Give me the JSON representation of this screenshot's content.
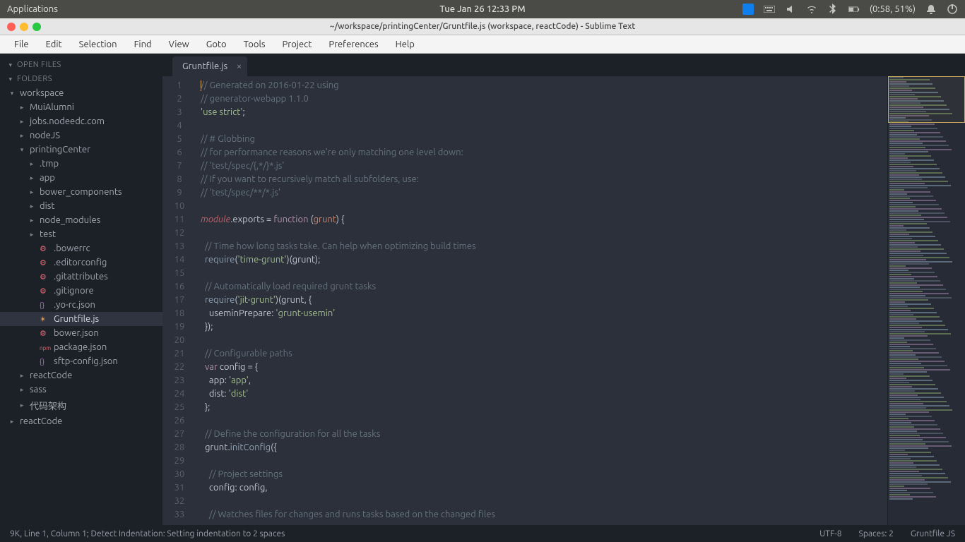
{
  "topbar": {
    "applications": "Applications",
    "datetime": "Tue Jan 26 12:33 PM",
    "battery": "(0:58, 51%)"
  },
  "window": {
    "title": "~/workspace/printingCenter/Gruntfile.js (workspace, reactCode) - Sublime Text"
  },
  "menu": [
    "File",
    "Edit",
    "Selection",
    "Find",
    "View",
    "Goto",
    "Tools",
    "Project",
    "Preferences",
    "Help"
  ],
  "sidebar": {
    "open_files": "OPEN FILES",
    "folders": "FOLDERS",
    "tree": [
      {
        "l": "workspace",
        "d": 1,
        "exp": true,
        "i": 0
      },
      {
        "l": "MuiAlumni",
        "d": 1,
        "i": 1
      },
      {
        "l": "jobs.nodeedc.com",
        "d": 1,
        "i": 1
      },
      {
        "l": "nodeJS",
        "d": 1,
        "i": 1
      },
      {
        "l": "printingCenter",
        "d": 1,
        "exp": true,
        "i": 1
      },
      {
        "l": ".tmp",
        "d": 1,
        "i": 2
      },
      {
        "l": "app",
        "d": 1,
        "i": 2
      },
      {
        "l": "bower_components",
        "d": 1,
        "i": 2
      },
      {
        "l": "dist",
        "d": 1,
        "i": 2
      },
      {
        "l": "node_modules",
        "d": 1,
        "i": 2
      },
      {
        "l": "test",
        "d": 1,
        "i": 2
      },
      {
        "l": ".bowerrc",
        "ic": "config",
        "i": 2
      },
      {
        "l": ".editorconfig",
        "ic": "config",
        "i": 2
      },
      {
        "l": ".gitattributes",
        "ic": "config",
        "i": 2
      },
      {
        "l": ".gitignore",
        "ic": "config",
        "i": 2
      },
      {
        "l": ".yo-rc.json",
        "ic": "json",
        "i": 2
      },
      {
        "l": "Gruntfile.js",
        "ic": "js",
        "i": 2,
        "sel": true
      },
      {
        "l": "bower.json",
        "ic": "config",
        "i": 2
      },
      {
        "l": "package.json",
        "ic": "pkg",
        "i": 2
      },
      {
        "l": "sftp-config.json",
        "ic": "json",
        "i": 2
      },
      {
        "l": "reactCode",
        "d": 1,
        "i": 1
      },
      {
        "l": "sass",
        "d": 1,
        "i": 1
      },
      {
        "l": "代码架构",
        "d": 1,
        "i": 1
      },
      {
        "l": "reactCode",
        "d": 1,
        "i": 0
      }
    ]
  },
  "tab": {
    "label": "Gruntfile.js"
  },
  "code_lines": [
    [
      {
        "c": "cm",
        "t": "// Generated on 2016-01-22 using"
      }
    ],
    [
      {
        "c": "cm",
        "t": "// generator-webapp 1.1.0"
      }
    ],
    [
      {
        "c": "str",
        "t": "'use strict'"
      },
      {
        "c": "op",
        "t": ";"
      }
    ],
    [],
    [
      {
        "c": "cm",
        "t": "// # Globbing"
      }
    ],
    [
      {
        "c": "cm",
        "t": "// for performance reasons we're only matching one level down:"
      }
    ],
    [
      {
        "c": "cm",
        "t": "// 'test/spec/{,*/}*.js'"
      }
    ],
    [
      {
        "c": "cm",
        "t": "// If you want to recursively match all subfolders, use:"
      }
    ],
    [
      {
        "c": "cm",
        "t": "// 'test/spec/**/*.js'"
      }
    ],
    [],
    [
      {
        "c": "red",
        "t": "module"
      },
      {
        "c": "op",
        "t": "."
      },
      {
        "c": "var",
        "t": "exports"
      },
      {
        "c": "op",
        "t": " = "
      },
      {
        "c": "kw",
        "t": "function"
      },
      {
        "c": "op",
        "t": " ("
      },
      {
        "c": "num",
        "t": "grunt"
      },
      {
        "c": "op",
        "t": ") {"
      }
    ],
    [],
    [
      {
        "c": "op",
        "t": "  "
      },
      {
        "c": "cm",
        "t": "// Time how long tasks take. Can help when optimizing build times"
      }
    ],
    [
      {
        "c": "op",
        "t": "  "
      },
      {
        "c": "fn",
        "t": "require"
      },
      {
        "c": "op",
        "t": "("
      },
      {
        "c": "str",
        "t": "'time-grunt'"
      },
      {
        "c": "op",
        "t": ")(grunt);"
      }
    ],
    [],
    [
      {
        "c": "op",
        "t": "  "
      },
      {
        "c": "cm",
        "t": "// Automatically load required grunt tasks"
      }
    ],
    [
      {
        "c": "op",
        "t": "  "
      },
      {
        "c": "fn",
        "t": "require"
      },
      {
        "c": "op",
        "t": "("
      },
      {
        "c": "str",
        "t": "'jit-grunt'"
      },
      {
        "c": "op",
        "t": ")(grunt, {"
      }
    ],
    [
      {
        "c": "op",
        "t": "    useminPrepare: "
      },
      {
        "c": "str",
        "t": "'grunt-usemin'"
      }
    ],
    [
      {
        "c": "op",
        "t": "  });"
      }
    ],
    [],
    [
      {
        "c": "op",
        "t": "  "
      },
      {
        "c": "cm",
        "t": "// Configurable paths"
      }
    ],
    [
      {
        "c": "op",
        "t": "  "
      },
      {
        "c": "kw",
        "t": "var"
      },
      {
        "c": "op",
        "t": " config = {"
      }
    ],
    [
      {
        "c": "op",
        "t": "    app: "
      },
      {
        "c": "str",
        "t": "'app'"
      },
      {
        "c": "op",
        "t": ","
      }
    ],
    [
      {
        "c": "op",
        "t": "    dist: "
      },
      {
        "c": "str",
        "t": "'dist'"
      }
    ],
    [
      {
        "c": "op",
        "t": "  };"
      }
    ],
    [],
    [
      {
        "c": "op",
        "t": "  "
      },
      {
        "c": "cm",
        "t": "// Define the configuration for all the tasks"
      }
    ],
    [
      {
        "c": "op",
        "t": "  grunt."
      },
      {
        "c": "fn",
        "t": "initConfig"
      },
      {
        "c": "op",
        "t": "({"
      }
    ],
    [],
    [
      {
        "c": "op",
        "t": "    "
      },
      {
        "c": "cm",
        "t": "// Project settings"
      }
    ],
    [
      {
        "c": "op",
        "t": "    config: config,"
      }
    ],
    [],
    [
      {
        "c": "op",
        "t": "    "
      },
      {
        "c": "cm",
        "t": "// Watches files for changes and runs tasks based on the changed files"
      }
    ]
  ],
  "status": {
    "left": "9K, Line 1, Column 1; Detect Indentation: Setting indentation to 2 spaces",
    "encoding": "UTF-8",
    "spaces": "Spaces: 2",
    "syntax": "Gruntfile JS"
  }
}
